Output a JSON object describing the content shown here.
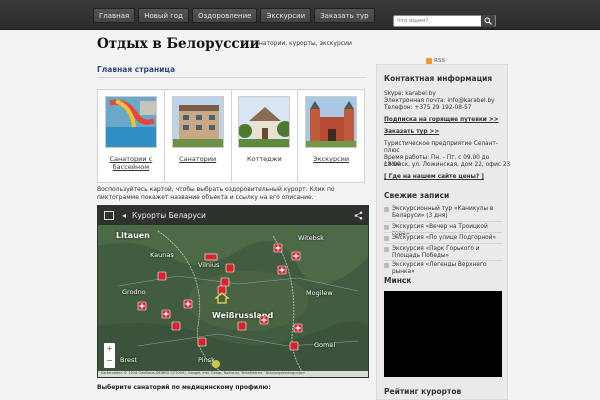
{
  "nav": [
    "Главная",
    "Новый год",
    "Оздоровление",
    "Экскурсии",
    "Заказать тур"
  ],
  "search": {
    "placeholder": "Что ищем?"
  },
  "site": {
    "title": "Отдых в Белоруссии",
    "description": "Санатории, курорты, экскурсии"
  },
  "rss": "RSS",
  "main": {
    "title": "Главная страница",
    "tiles": [
      {
        "label": "Санатории с бассейном",
        "icon": "pool-photo",
        "link": true
      },
      {
        "label": "Санатории",
        "icon": "sanatorium-photo",
        "link": true
      },
      {
        "label": "Коттеджи",
        "icon": "cottage-photo",
        "link": false
      },
      {
        "label": "Экскурсии",
        "icon": "castle-photo",
        "link": true
      }
    ],
    "intro": "Воспользуйтесь картой, чтобы выбрать оздоровительный курорт. Клик по пиктограмме покажет название объекта и ссылку на его описание.",
    "bottom_question": "Выберите санаторий по медицинскому профилю:"
  },
  "map": {
    "title": "Курорты Беларуси",
    "places": [
      "Litauen",
      "Kaunas",
      "Vilnius",
      "Weißrussland",
      "Grodno",
      "Witebsk",
      "Mogilew",
      "Gomel",
      "Brest",
      "Pinsk"
    ],
    "footer": "Kartendaten © 2016 GeoBasis-DE/BKG (©2009), Google, Inst. Geogr. Nacional, TerraMetrics · Nutzungsbedingungen",
    "zoom_in": "+",
    "zoom_out": "−"
  },
  "sidebar": {
    "contact_title": "Контактная информация",
    "skype": "Skype: karabel.by",
    "email": "Электронная почта: info@karabel.by",
    "phone": "Телефон: +375 29 192-08-57",
    "link_hot": "Подписка на горящие путевки >>",
    "link_order": "Заказать тур >>",
    "agency": "Туристическое предприятие Селант-плюс",
    "hours": "Время работы: Пн. - Пт. с 09.00 до 18.00",
    "address": "г.Минск, ул. Ложинская, дом 22, офис 23",
    "prices_link": "[ Где на нашем сайте цены? ]",
    "recent_title": "Свежие записи",
    "posts": [
      "Экскурсионный тур «Каникулы в Беларуси» (3 дня)",
      "Экскурсия «Вечер на Троицкой горе»",
      "Экскурсия «По улице Подгорной»",
      "Экскурсия «Парк Горького и Площадь Победы»",
      "Экскурсия «Легенды Верхнего рынка»"
    ],
    "minsk_title": "Минск",
    "rating_title": "Рейтинг курортов"
  },
  "colors": {
    "topbar": "#2f2f2f",
    "title_blue": "#2c4a75",
    "map_green": "#3f5a40",
    "marker_red": "#d6242b"
  }
}
